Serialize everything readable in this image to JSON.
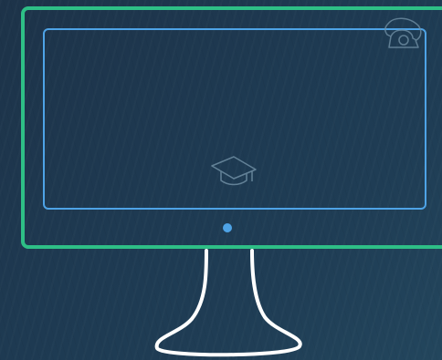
{
  "illustration": {
    "subject": "computer-monitor",
    "icons": [
      "graduation-cap-icon",
      "phone-icon"
    ],
    "colors": {
      "background_dark": "#1d3349",
      "background_light": "#23465d",
      "bezel": "#2ebf86",
      "screen_outline": "#4ea3e6",
      "power_led": "#4ea3e6",
      "stand": "#ffffff",
      "faint_icon": "#6f8ea3"
    }
  }
}
